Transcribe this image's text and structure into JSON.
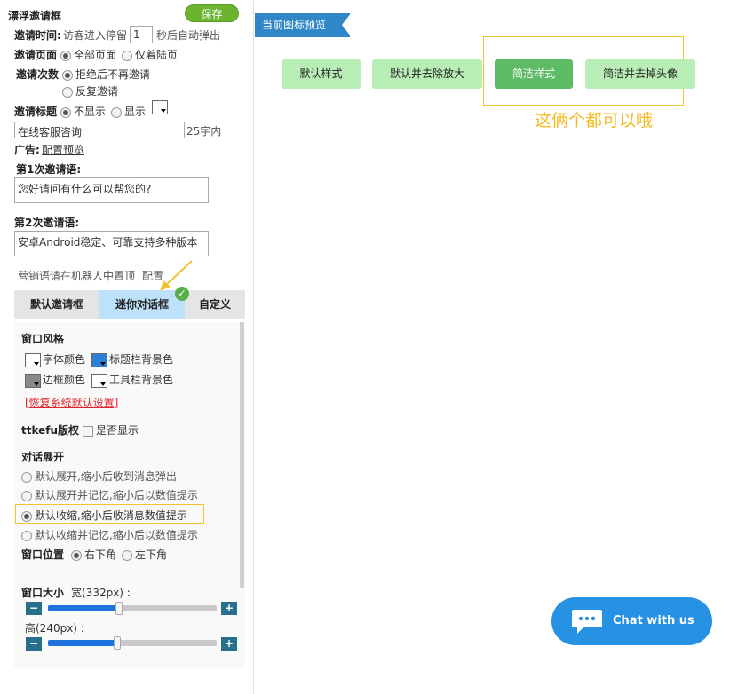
{
  "left": {
    "title": "漂浮邀请框",
    "save_label": "保存",
    "time_label": "邀请时间:",
    "time_prefix": "访客进入停留",
    "time_value": "1",
    "time_suffix": "秒后自动弹出",
    "page_label": "邀请页面",
    "page_opt1": "全部页面",
    "page_opt2": "仅着陆页",
    "count_label": "邀请次数",
    "count_opt1": "拒绝后不再邀请",
    "count_opt2": "反复邀请",
    "titlerow_label": "邀请标题",
    "titlerow_opt1": "不显示",
    "titlerow_opt2": "显示",
    "title_input": "在线客服咨询",
    "title_limit": "25字内",
    "ad_label": "广告:",
    "ad_link": "配置预览",
    "invite1_label": "第1次邀请语:",
    "invite1_text": "您好请问有什么可以帮您的?",
    "invite2_label": "第2次邀请语:",
    "invite2_text": "安卓Android稳定、可靠支持多种版本",
    "marketing_text": "营销语请在机器人中置顶",
    "marketing_link": "配置"
  },
  "tabs": [
    "默认邀请框",
    "迷你对话框",
    "自定义"
  ],
  "panel": {
    "window_style": "窗口风格",
    "font_color": "字体颜色",
    "titlebar_bg": "标题栏背景色",
    "border_color": "边框颜色",
    "toolbar_bg": "工具栏背景色",
    "restore_link": "[恢复系统默认设置]",
    "copyright_label": "ttkefu版权",
    "copyright_check": "是否显示",
    "expand_label": "对话展开",
    "expand_opt1": "默认展开,缩小后收到消息弹出",
    "expand_opt2": "默认展开并记忆,缩小后以数值提示",
    "expand_opt3": "默认收缩,缩小后收消息数值提示",
    "expand_opt4": "默认收缩并记忆,缩小后以数值提示",
    "position_label": "窗口位置",
    "position_opt1": "右下角",
    "position_opt2": "左下角",
    "size_label": "窗口大小",
    "width_label": "宽(332px) :",
    "height_label": "高(240px) :",
    "minus": "−",
    "plus": "+",
    "width_level": 0.42,
    "height_level": 0.41
  },
  "preview": {
    "ribbon": "当前图标预览",
    "buttons": [
      "默认样式",
      "默认并去除放大",
      "简洁样式",
      "简洁并去掉头像"
    ],
    "note": "这俩个都可以哦",
    "chat_label": "Chat with us"
  },
  "colors": {
    "accent_blue": "#2f87c7",
    "green_light": "#b8eeb6",
    "green_dark": "#5dbb65",
    "highlight_yellow": "#f1c232",
    "chat_blue": "#2792e3"
  }
}
